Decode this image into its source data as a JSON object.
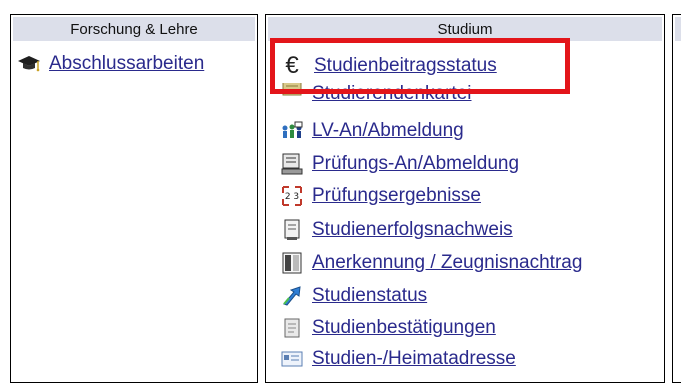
{
  "left_column": {
    "header": "Forschung & Lehre",
    "items": [
      {
        "label": "Abschlussarbeiten",
        "icon": "graduation-cap-icon"
      }
    ]
  },
  "middle_column": {
    "header": "Studium",
    "items": [
      {
        "label": "Studienbeitragsstatus",
        "icon": "euro-icon"
      },
      {
        "label": "Studierendenkartei",
        "icon": "card-file-icon"
      },
      {
        "label": "LV-An/Abmeldung",
        "icon": "people-icon"
      },
      {
        "label": "Prüfungs-An/Abmeldung",
        "icon": "exam-register-icon"
      },
      {
        "label": "Prüfungsergebnisse",
        "icon": "exam-results-icon"
      },
      {
        "label": "Studienerfolgsnachweis",
        "icon": "document-icon"
      },
      {
        "label": "Anerkennung / Zeugnisnachtrag",
        "icon": "certificate-icon"
      },
      {
        "label": "Studienstatus",
        "icon": "status-arrow-icon"
      },
      {
        "label": "Studienbestätigungen",
        "icon": "confirmation-doc-icon"
      },
      {
        "label": "Studien-/Heimatadresse",
        "icon": "address-card-icon"
      }
    ]
  },
  "colors": {
    "link": "#2a2a8c",
    "header_bg": "#dcdfea",
    "highlight": "#e3151a"
  }
}
